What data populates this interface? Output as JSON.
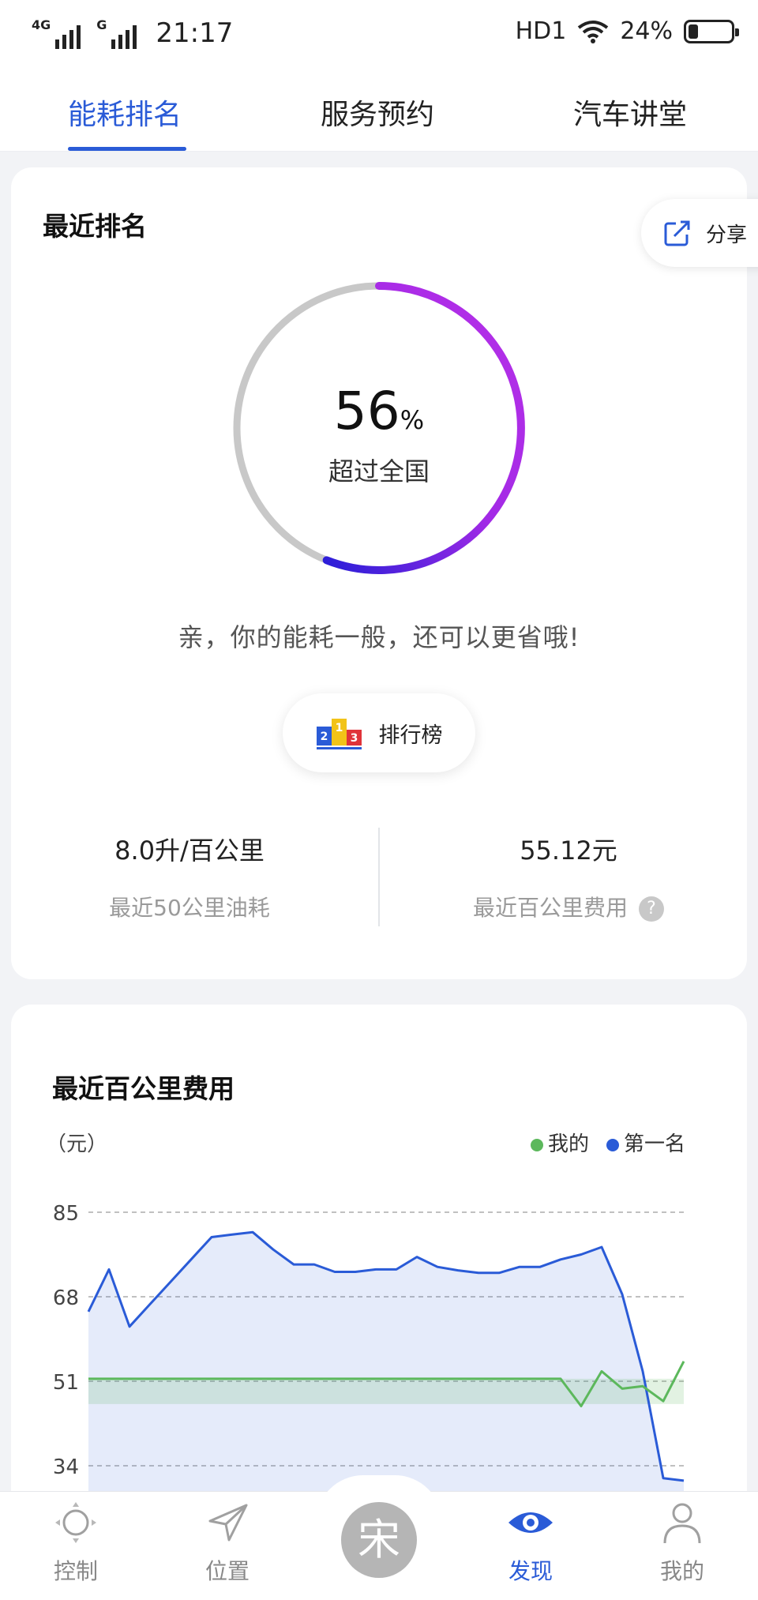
{
  "status_bar": {
    "network_1": "4G",
    "network_2": "G",
    "time": "21:17",
    "hd": "HD1",
    "battery": "24%",
    "battery_level": 0.24
  },
  "tabs": [
    {
      "label": "能耗排名",
      "active": true
    },
    {
      "label": "服务预约",
      "active": false
    },
    {
      "label": "汽车讲堂",
      "active": false
    }
  ],
  "ranking": {
    "title": "最近排名",
    "share_label": "分享",
    "percent": "56",
    "percent_unit": "%",
    "percent_value": 56,
    "gauge_label": "超过全国",
    "hint": "亲，你的能耗一般，还可以更省哦!",
    "rank_button": "排行榜",
    "stats": [
      {
        "value": "8.0升/百公里",
        "label": "最近50公里油耗"
      },
      {
        "value": "55.12元",
        "label": "最近百公里费用"
      }
    ],
    "help_icon": "?"
  },
  "cost_chart": {
    "title": "最近百公里费用",
    "unit_label": "（元）",
    "legend": [
      {
        "name": "我的",
        "color": "#5cb85c"
      },
      {
        "name": "第一名",
        "color": "#2a5bd7"
      }
    ]
  },
  "chart_data": {
    "type": "line",
    "title": "最近百公里费用",
    "ylabel": "（元）",
    "ylim": [
      27,
      85
    ],
    "yticks": [
      85,
      68,
      51,
      34
    ],
    "grid": true,
    "legend_position": "top-right",
    "x": [
      1,
      2,
      3,
      4,
      5,
      6,
      7,
      8,
      9,
      10,
      11,
      12,
      13,
      14,
      15,
      16,
      17,
      18,
      19,
      20,
      21,
      22,
      23,
      24,
      25,
      26,
      27,
      28,
      29,
      30
    ],
    "series": [
      {
        "name": "第一名",
        "color": "#2a5bd7",
        "values": [
          65,
          73.5,
          62,
          66.5,
          71,
          75.5,
          80,
          80.5,
          81,
          77.5,
          74.5,
          74.5,
          73,
          73,
          73.5,
          73.5,
          76,
          74,
          73.3,
          72.8,
          72.8,
          74,
          74,
          75.5,
          76.5,
          78,
          68.5,
          53,
          31.5,
          31
        ]
      },
      {
        "name": "我的",
        "color": "#5cb85c",
        "values": [
          51.5,
          51.5,
          51.5,
          51.5,
          51.5,
          51.5,
          51.5,
          51.5,
          51.5,
          51.5,
          51.5,
          51.5,
          51.5,
          51.5,
          51.5,
          51.5,
          51.5,
          51.5,
          51.5,
          51.5,
          51.5,
          51.5,
          51.5,
          51.5,
          46,
          53,
          49.5,
          50,
          47,
          55
        ]
      }
    ]
  },
  "bottom_nav": [
    {
      "label": "控制",
      "icon": "target-icon",
      "active": false
    },
    {
      "label": "位置",
      "icon": "navigation-icon",
      "active": false
    },
    {
      "label": "宋",
      "icon": "brand-logo",
      "active": false
    },
    {
      "label": "发现",
      "icon": "eye-icon",
      "active": true
    },
    {
      "label": "我的",
      "icon": "person-icon",
      "active": false
    }
  ]
}
